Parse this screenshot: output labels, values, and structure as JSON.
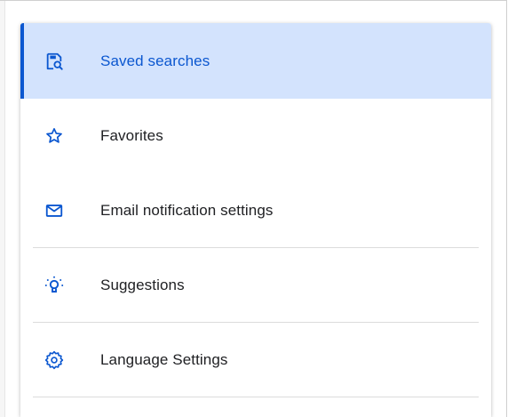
{
  "menu": {
    "items": [
      {
        "label": "Saved searches",
        "icon": "saved-search-icon",
        "selected": true
      },
      {
        "label": "Favorites",
        "icon": "star-icon",
        "selected": false
      },
      {
        "label": "Email notification settings",
        "icon": "mail-icon",
        "selected": false
      },
      {
        "label": "Suggestions",
        "icon": "lightbulb-icon",
        "selected": false
      },
      {
        "label": "Language Settings",
        "icon": "gear-icon",
        "selected": false
      }
    ]
  },
  "colors": {
    "accent": "#0b57d0",
    "selected_bg": "#d3e3fd",
    "text": "#202124",
    "divider": "#dcdcdc"
  }
}
